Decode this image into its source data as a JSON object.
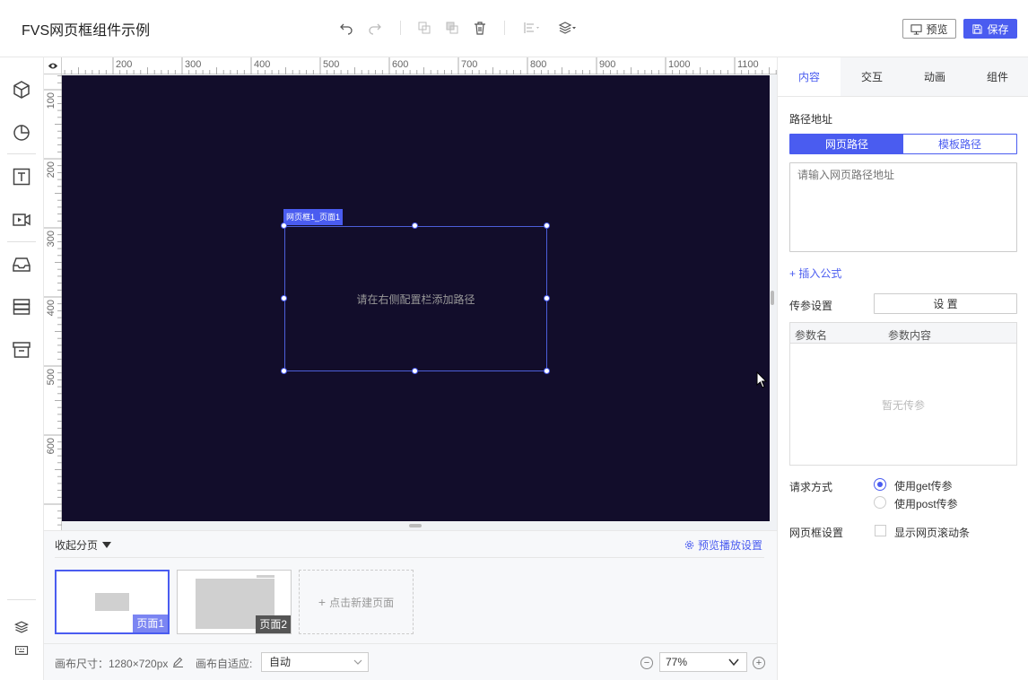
{
  "app": {
    "title": "FVS网页框组件示例"
  },
  "toolbar": {
    "icons": [
      "undo-icon",
      "redo-icon",
      "copy-icon",
      "paste-icon",
      "trash-icon",
      "align-icon",
      "layer-icon"
    ],
    "preview_label": "预览",
    "save_label": "保存",
    "accent": "#4a5cf0"
  },
  "sidebar": {
    "items": [
      "cube-icon",
      "chart-pie-icon",
      "text-icon",
      "video-icon",
      "inbox-icon",
      "database-icon",
      "archive-icon",
      "layers-icon",
      "keyboard-icon"
    ]
  },
  "ruler": {
    "horizontal": [
      "200",
      "300",
      "400",
      "500",
      "600",
      "700",
      "800",
      "900",
      "1000",
      "1100"
    ],
    "vertical": [
      "100",
      "200",
      "300",
      "400",
      "500",
      "600"
    ]
  },
  "canvas": {
    "background": "#120d2b",
    "frame_tag": "网页框1_页面1",
    "frame_hint": "请在右侧配置栏添加路径"
  },
  "pages": {
    "collapse_label": "收起分页",
    "preview_settings_label": "预览播放设置",
    "items": [
      {
        "label": "页面1",
        "active": true
      },
      {
        "label": "页面2",
        "active": false
      }
    ],
    "new_page_label": "点击新建页面"
  },
  "status": {
    "canvas_size": "画布尺寸：1280×720px",
    "fit_label": "画布自适应:",
    "fit_value": "自动",
    "zoom_value": "77%"
  },
  "right_panel": {
    "tabs": [
      {
        "label": "内容",
        "active": true
      },
      {
        "label": "交互",
        "active": false
      },
      {
        "label": "动画",
        "active": false
      },
      {
        "label": "组件",
        "active": false
      }
    ],
    "path_label": "路径地址",
    "path_types": [
      {
        "label": "网页路径",
        "active": true
      },
      {
        "label": "模板路径",
        "active": false
      }
    ],
    "path_placeholder": "请输入网页路径地址",
    "insert_formula": "+ 插入公式",
    "param_label": "传参设置",
    "param_button": "设 置",
    "param_columns": [
      "参数名",
      "参数内容"
    ],
    "param_empty": "暂无传参",
    "request_label": "请求方式",
    "request_options": [
      {
        "label": "使用get传参",
        "checked": true
      },
      {
        "label": "使用post传参",
        "checked": false
      }
    ],
    "frame_settings_label": "网页框设置",
    "scroll_option": "显示网页滚动条"
  }
}
